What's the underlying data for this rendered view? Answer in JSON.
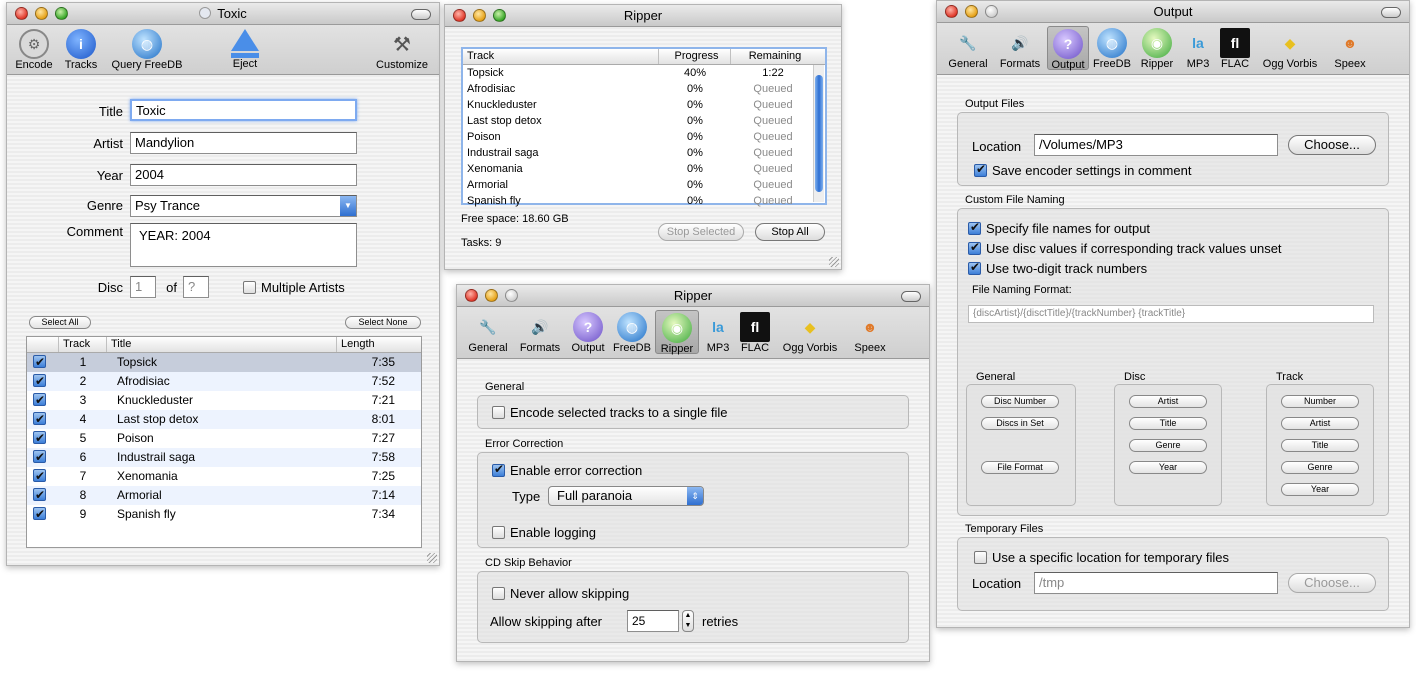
{
  "main": {
    "title": "Toxic",
    "toolbar": [
      "Encode",
      "Tracks",
      "Query FreeDB",
      "Eject",
      "Customize"
    ],
    "labels": {
      "title": "Title",
      "artist": "Artist",
      "year": "Year",
      "genre": "Genre",
      "comment": "Comment",
      "disc": "Disc",
      "of": "of",
      "multiple": "Multiple Artists"
    },
    "values": {
      "title": "Toxic",
      "artist": "Mandylion",
      "year": "2004",
      "genre": "Psy Trance",
      "comment": "YEAR: 2004",
      "disc": "1",
      "of": "?"
    },
    "select_all": "Select All",
    "select_none": "Select None",
    "columns": [
      "Track",
      "Title",
      "Length"
    ],
    "tracks": [
      {
        "n": "1",
        "t": "Topsick",
        "l": "7:35"
      },
      {
        "n": "2",
        "t": "Afrodisiac",
        "l": "7:52"
      },
      {
        "n": "3",
        "t": "Knuckleduster",
        "l": "7:21"
      },
      {
        "n": "4",
        "t": "Last stop detox",
        "l": "8:01"
      },
      {
        "n": "5",
        "t": "Poison",
        "l": "7:27"
      },
      {
        "n": "6",
        "t": "Industrail saga",
        "l": "7:58"
      },
      {
        "n": "7",
        "t": "Xenomania",
        "l": "7:25"
      },
      {
        "n": "8",
        "t": "Armorial",
        "l": "7:14"
      },
      {
        "n": "9",
        "t": "Spanish fly",
        "l": "7:34"
      }
    ]
  },
  "ripper": {
    "title": "Ripper",
    "columns": [
      "Track",
      "Progress",
      "Remaining"
    ],
    "rows": [
      {
        "t": "Topsick",
        "p": "40%",
        "r": "1:22"
      },
      {
        "t": "Afrodisiac",
        "p": "0%",
        "r": "Queued"
      },
      {
        "t": "Knuckleduster",
        "p": "0%",
        "r": "Queued"
      },
      {
        "t": "Last stop detox",
        "p": "0%",
        "r": "Queued"
      },
      {
        "t": "Poison",
        "p": "0%",
        "r": "Queued"
      },
      {
        "t": "Industrail saga",
        "p": "0%",
        "r": "Queued"
      },
      {
        "t": "Xenomania",
        "p": "0%",
        "r": "Queued"
      },
      {
        "t": "Armorial",
        "p": "0%",
        "r": "Queued"
      },
      {
        "t": "Spanish fly",
        "p": "0%",
        "r": "Queued"
      }
    ],
    "free_space": "Free space: 18.60 GB",
    "tasks": "Tasks: 9",
    "stop_selected": "Stop Selected",
    "stop_all": "Stop All"
  },
  "prefs_tabs": [
    "General",
    "Formats",
    "Output",
    "FreeDB",
    "Ripper",
    "MP3",
    "FLAC",
    "Ogg Vorbis",
    "Speex"
  ],
  "ripper_prefs": {
    "title": "Ripper",
    "general": "General",
    "encode_single": "Encode selected tracks to a single file",
    "error_correction": "Error Correction",
    "enable_ec": "Enable error correction",
    "type_label": "Type",
    "type_value": "Full paranoia",
    "enable_logging": "Enable logging",
    "skip": "CD Skip Behavior",
    "never_skip": "Never allow skipping",
    "allow_after": "Allow skipping after",
    "retries_value": "25",
    "retries": "retries"
  },
  "output_prefs": {
    "title": "Output",
    "output_files": "Output Files",
    "location": "Location",
    "location_value": "/Volumes/MP3",
    "choose": "Choose...",
    "save_settings": "Save encoder settings in comment",
    "custom": "Custom File Naming",
    "specify": "Specify file names for output",
    "disc_values": "Use disc values if corresponding track values unset",
    "two_digit": "Use two-digit track numbers",
    "format_label": "File Naming Format:",
    "format_value": "{discArtist}/{disctTitle}/{trackNumber} {trackTitle}",
    "general": "General",
    "disc": "Disc",
    "track": "Track",
    "general_btns": [
      "Disc Number",
      "Discs in Set",
      "File Format"
    ],
    "disc_btns": [
      "Artist",
      "Title",
      "Genre",
      "Year"
    ],
    "track_btns": [
      "Number",
      "Artist",
      "Title",
      "Genre",
      "Year"
    ],
    "temp": "Temporary Files",
    "temp_specific": "Use a specific location for temporary files",
    "temp_location": "Location",
    "temp_value": "/tmp",
    "temp_choose": "Choose..."
  },
  "colors": {
    "accent": "#3d7fd8",
    "selection": "#c6cddb",
    "alt_row": "#edf3fe"
  }
}
